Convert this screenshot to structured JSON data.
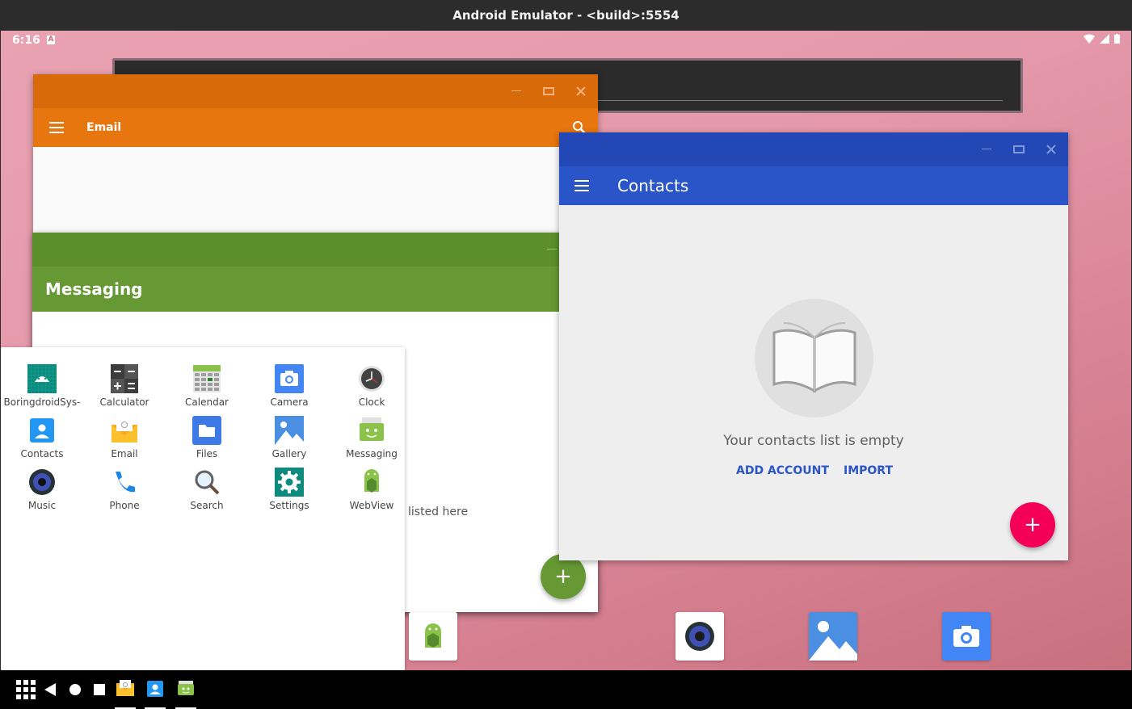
{
  "window": {
    "title": "Android Emulator - <build>:5554"
  },
  "status_bar": {
    "time": "6:16",
    "notification": "A",
    "icons": [
      "wifi-icon",
      "signal-icon",
      "battery-icon"
    ]
  },
  "email_window": {
    "title": "Email",
    "color": "#e8760f"
  },
  "messaging_window": {
    "title": "Messaging",
    "empty_text": "listed here",
    "color": "#669933"
  },
  "contacts_window": {
    "title": "Contacts",
    "empty_message": "Your contacts list is empty",
    "add_account_label": "ADD ACCOUNT",
    "import_label": "IMPORT",
    "color": "#2a55c9",
    "accent": "#f50057"
  },
  "launcher": {
    "apps": [
      {
        "label": "BoringdroidSys-",
        "icon": "android-icon"
      },
      {
        "label": "Calculator",
        "icon": "calculator-icon"
      },
      {
        "label": "Calendar",
        "icon": "calendar-icon"
      },
      {
        "label": "Camera",
        "icon": "camera-icon"
      },
      {
        "label": "Clock",
        "icon": "clock-icon"
      },
      {
        "label": "Contacts",
        "icon": "contacts-icon"
      },
      {
        "label": "Email",
        "icon": "email-icon"
      },
      {
        "label": "Files",
        "icon": "files-icon"
      },
      {
        "label": "Gallery",
        "icon": "gallery-icon"
      },
      {
        "label": "Messaging",
        "icon": "messaging-icon"
      },
      {
        "label": "Music",
        "icon": "music-icon"
      },
      {
        "label": "Phone",
        "icon": "phone-icon"
      },
      {
        "label": "Search",
        "icon": "search-icon"
      },
      {
        "label": "Settings",
        "icon": "settings-icon"
      },
      {
        "label": "WebView",
        "icon": "webview-icon"
      }
    ]
  },
  "taskbar": {
    "buttons": [
      "apps-grid-icon",
      "back-icon",
      "home-icon",
      "recents-icon"
    ],
    "pinned": [
      "email-icon",
      "contacts-icon",
      "messaging-icon"
    ]
  },
  "dock": [
    "webview-icon",
    "music-icon",
    "gallery-icon",
    "camera-icon"
  ]
}
